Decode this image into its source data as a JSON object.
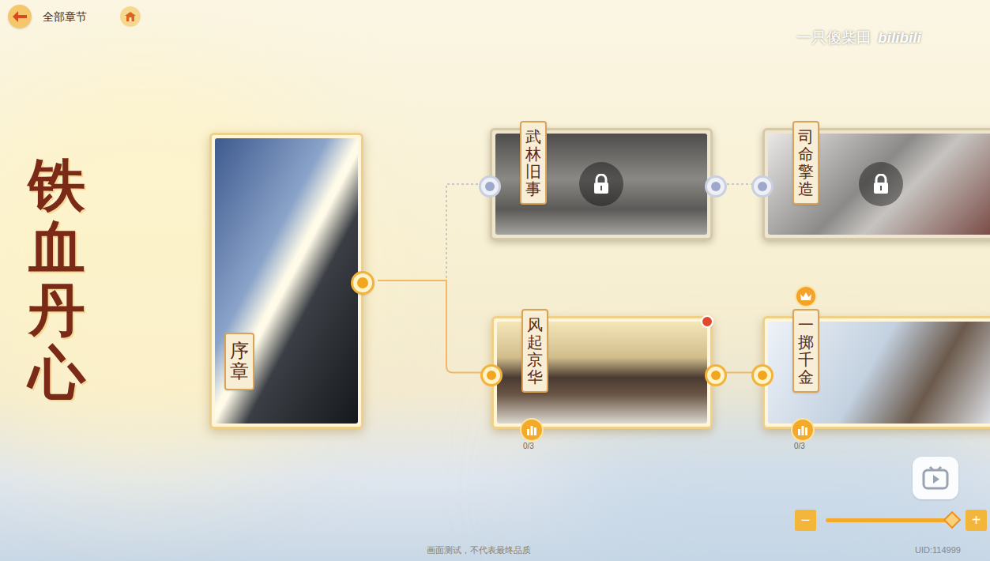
{
  "topbar": {
    "title": "全部章节"
  },
  "watermark": {
    "author": "一只傻柴田",
    "site": "bilibili"
  },
  "game_title": "铁血丹心",
  "prologue": {
    "label": "序章"
  },
  "chapters": [
    {
      "label": "武林旧事",
      "kind": "locked",
      "new": false,
      "crowned": false
    },
    {
      "label": "司命擎造",
      "kind": "locked",
      "new": false,
      "crowned": false
    },
    {
      "label": "风起京华",
      "kind": "open",
      "new": true,
      "crowned": false,
      "progress": "0/3"
    },
    {
      "label": "一掷千金",
      "kind": "open",
      "new": false,
      "crowned": true,
      "progress": "0/3"
    }
  ],
  "zoom": {
    "minus": "−",
    "plus": "+",
    "level": 0.97
  },
  "notice": "画面测试，不代表最终品质",
  "uid": "UID:114999"
}
